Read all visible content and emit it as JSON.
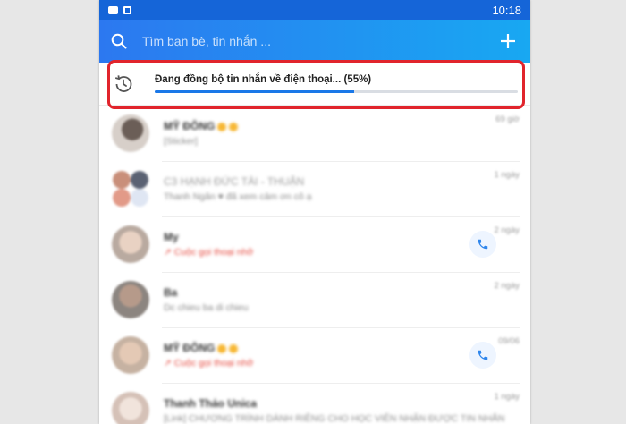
{
  "status_bar": {
    "time": "10:18"
  },
  "search": {
    "placeholder": "Tìm bạn bè, tin nhắn ..."
  },
  "sync": {
    "text": "Đang đồng bộ tin nhắn về điện thoại... (55%)",
    "progress_fraction": 0.55
  },
  "colors": {
    "header_start": "#2c78f0",
    "header_end": "#18a8f2",
    "progress": "#1a78e8",
    "annotation": "#e1242c",
    "missed_call": "#e5493f"
  },
  "conversations": [
    {
      "name": "MỸ ĐÔNG",
      "preview": "[Sticker]",
      "time": "69 giờ",
      "call": false,
      "missed": false
    },
    {
      "name": "C3 HẠNH ĐỨC TÀI - THUẬN",
      "preview": "Thanh Ngân ♥ đã xem cảm ơn cô ạ",
      "time": "1 ngày",
      "call": false,
      "missed": false
    },
    {
      "name": "My",
      "preview": "Cuộc gọi thoại nhỡ",
      "time": "2 ngày",
      "call": true,
      "missed": true
    },
    {
      "name": "Ba",
      "preview": "Dc chieu ba di chieu",
      "time": "2 ngày",
      "call": false,
      "missed": false
    },
    {
      "name": "MỸ ĐÔNG",
      "preview": "Cuộc gọi thoại nhỡ",
      "time": "09/06",
      "call": true,
      "missed": true
    },
    {
      "name": "Thanh Thảo Unica",
      "preview": "[Link] CHƯƠNG TRÌNH DÀNH RIÊNG CHO HỌC VIÊN NHẬN ĐƯỢC TIN NHẮN",
      "time": "1 ngày",
      "call": false,
      "missed": false
    }
  ]
}
